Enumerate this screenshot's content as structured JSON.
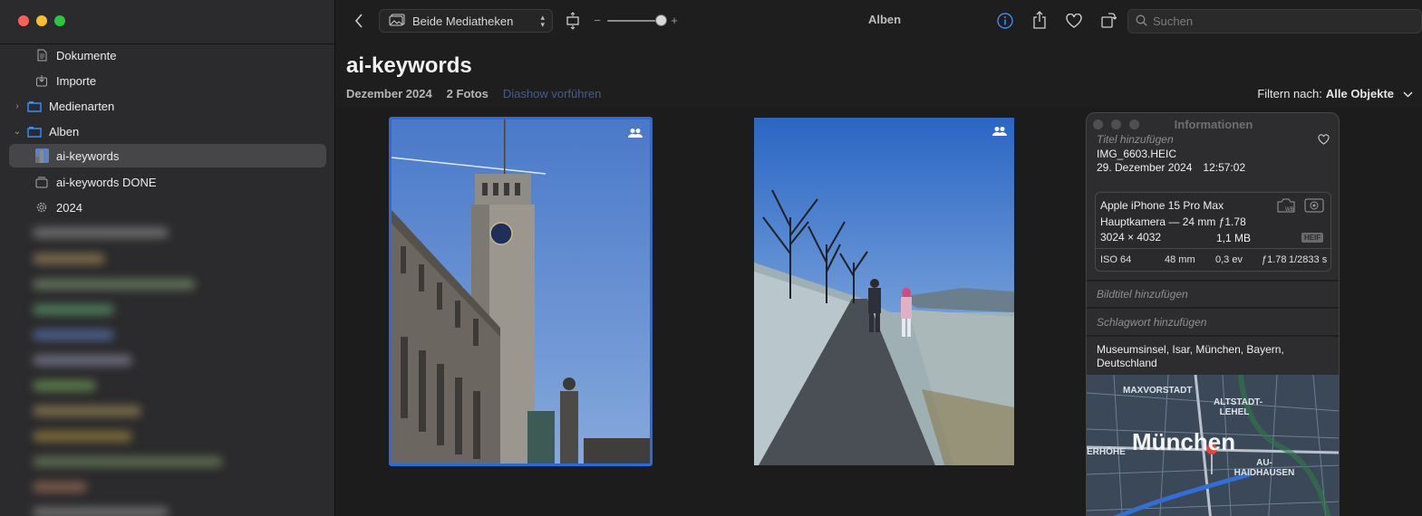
{
  "sidebar": {
    "items": [
      {
        "label": "Dokumente",
        "icon": "document-icon"
      },
      {
        "label": "Importe",
        "icon": "import-icon"
      },
      {
        "label": "Medienarten",
        "icon": "folder-icon"
      },
      {
        "label": "Alben",
        "icon": "folder-icon"
      },
      {
        "label": "ai-keywords",
        "icon": "album-thumbnail"
      },
      {
        "label": "ai-keywords DONE",
        "icon": "album-icon"
      },
      {
        "label": "2024",
        "icon": "smart-album-gear-icon"
      }
    ]
  },
  "toolbar": {
    "library_select": "Beide Mediatheken",
    "zoom_minus": "−",
    "zoom_plus": "+",
    "title": "Alben",
    "search_placeholder": "Suchen"
  },
  "album": {
    "title": "ai-keywords",
    "date": "Dezember 2024",
    "count": "2 Fotos",
    "slideshow": "Diashow vorführen",
    "filter_label": "Filtern nach:",
    "filter_value": "Alle Objekte"
  },
  "info": {
    "title": "Informationen",
    "title_placeholder": "Titel hinzufügen",
    "filename": "IMG_6603.HEIC",
    "date": "29. Dezember 2024",
    "time": "12:57:02",
    "camera": "Apple iPhone 15 Pro Max",
    "lens": "Hauptkamera — 24 mm ƒ1.78",
    "dimensions": "3024 × 4032",
    "size": "1,1 MB",
    "format_badge": "HEIF",
    "iso": "ISO 64",
    "focal": "48 mm",
    "ev": "0,3 ev",
    "aperture": "ƒ1.78",
    "shutter": "1/2833 s",
    "caption_placeholder": "Bildtitel hinzufügen",
    "keyword_placeholder": "Schlagwort hinzufügen",
    "location": "Museumsinsel, Isar, München, Bayern, Deutschland",
    "map_labels": {
      "maxvorstadt": "MAXVORSTADT",
      "altstadt": "ALTSTADT-\nLEHEL",
      "city": "München",
      "haidhausen": "AU-\nHAIDHAUSEN",
      "hohe": "ERHÖHE"
    }
  },
  "colors": {
    "accent": "#2a6ce0",
    "background": "#1e1e1e",
    "sidebar": "#2b2a2c"
  }
}
